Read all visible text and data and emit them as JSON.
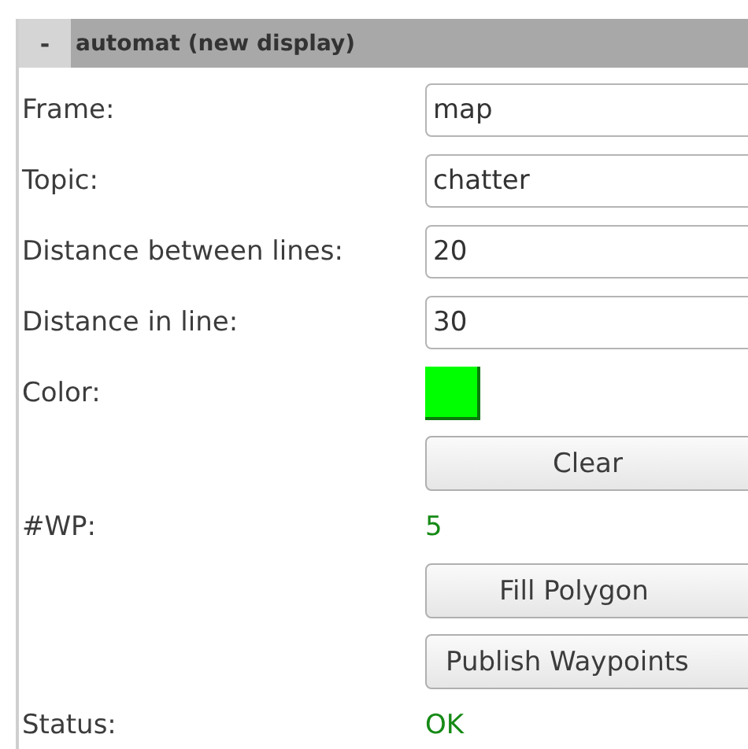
{
  "panel": {
    "collapse_toggle": "-",
    "title": "automat (new display)"
  },
  "rows": [
    {
      "kind": "field",
      "label": "Frame:",
      "value": "map"
    },
    {
      "kind": "field",
      "label": "Topic:",
      "value": "chatter"
    },
    {
      "kind": "field",
      "label": "Distance between lines:",
      "value": "20"
    },
    {
      "kind": "field",
      "label": "Distance in line:",
      "value": "30"
    },
    {
      "kind": "color",
      "label": "Color:",
      "color": "#00ff00"
    },
    {
      "kind": "button",
      "text": "Clear"
    },
    {
      "kind": "value",
      "label": "#WP:",
      "value": "5"
    },
    {
      "kind": "button",
      "text": "Fill Polygon"
    },
    {
      "kind": "button",
      "text": "Publish Waypoints"
    },
    {
      "kind": "value",
      "label": "Status:",
      "value": "OK"
    }
  ]
}
